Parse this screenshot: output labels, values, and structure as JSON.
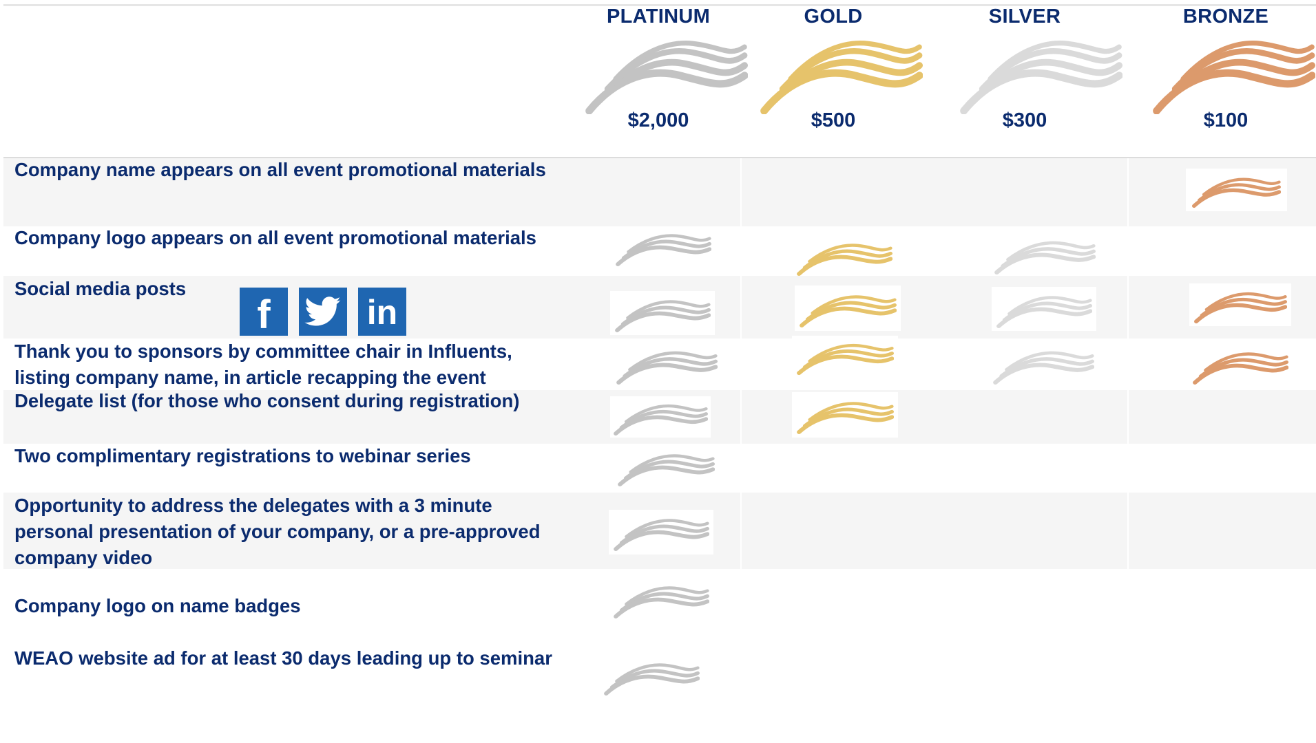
{
  "tiers": [
    {
      "name": "PLATINUM",
      "price": "$2,000",
      "color": "#c3c3c3"
    },
    {
      "name": "GOLD",
      "price": "$500",
      "color": "#e6c36b"
    },
    {
      "name": "SILVER",
      "price": "$300",
      "color": "#dadada"
    },
    {
      "name": "BRONZE",
      "price": "$100",
      "color": "#dc9a6c"
    }
  ],
  "benefits": [
    {
      "label": "Company name appears on all event promotional materials",
      "tiers": [
        "bronze"
      ]
    },
    {
      "label": "Company logo appears on all event promotional materials",
      "tiers": [
        "platinum",
        "gold",
        "silver"
      ]
    },
    {
      "label": "Social media posts",
      "tiers": [
        "platinum",
        "gold",
        "silver",
        "bronze"
      ]
    },
    {
      "label": "Thank you to sponsors by committee chair in Influents, listing company name, in article recapping the event",
      "tiers": [
        "platinum",
        "gold",
        "silver",
        "bronze"
      ]
    },
    {
      "label": "Delegate list (for those who consent during registration)",
      "tiers": [
        "platinum",
        "gold"
      ]
    },
    {
      "label": "Two complimentary registrations to webinar series",
      "tiers": [
        "platinum"
      ]
    },
    {
      "label": "Opportunity to address the delegates with a 3 minute personal presentation of your company, or a pre-approved company video",
      "tiers": [
        "platinum"
      ]
    },
    {
      "label": "Company logo on name badges",
      "tiers": [
        "platinum"
      ]
    },
    {
      "label": "WEAO website ad for at least 30 days leading up to seminar",
      "tiers": [
        "platinum"
      ]
    }
  ],
  "social_icons": [
    "facebook-icon",
    "twitter-icon",
    "linkedin-icon"
  ],
  "social_icon_color": "#1f66b1"
}
